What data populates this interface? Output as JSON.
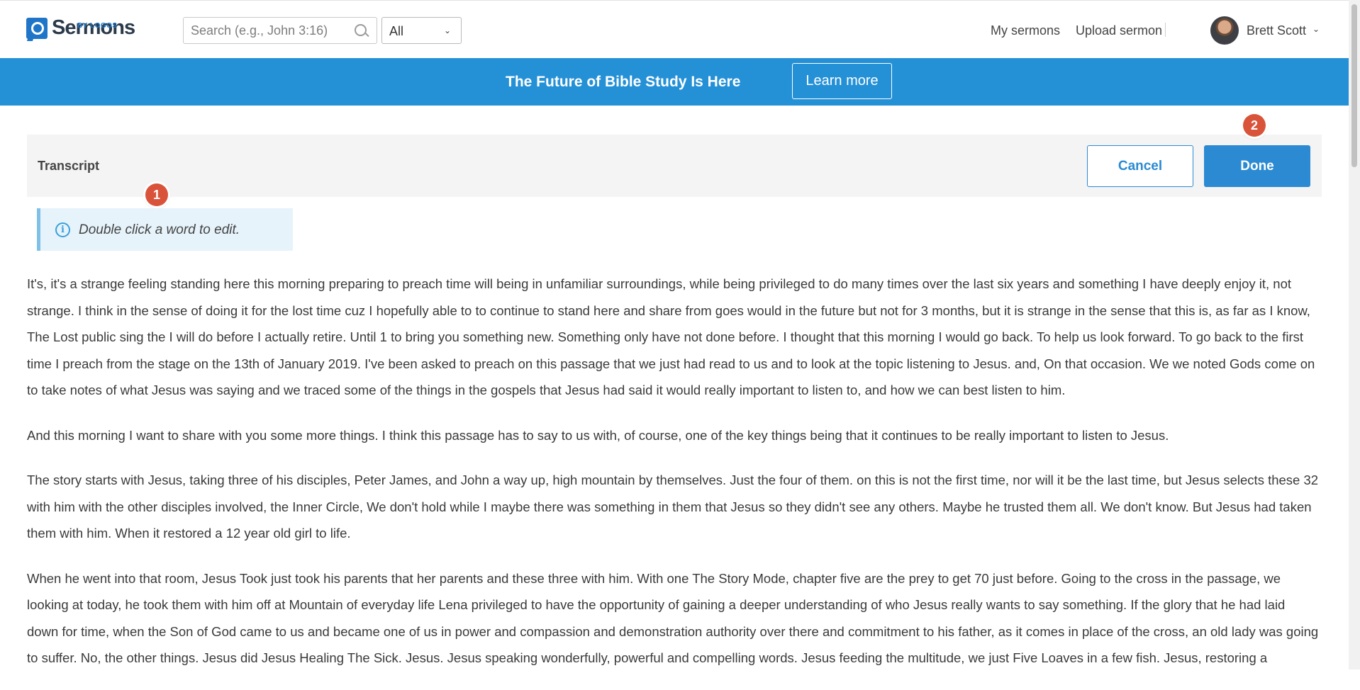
{
  "topbar": {
    "logo_text": "Sermons",
    "logo_sub": "BY LOGOS",
    "search_placeholder": "Search (e.g., John 3:16)",
    "filter_value": "All",
    "nav": {
      "my_sermons": "My sermons",
      "upload_sermon": "Upload sermon"
    },
    "user_name": "Brett Scott"
  },
  "banner": {
    "title": "The Future of Bible Study Is Here",
    "cta": "Learn more",
    "color": "#2490d6"
  },
  "editor": {
    "title": "Transcript",
    "cancel_label": "Cancel",
    "done_label": "Done",
    "info_text": "Double click a word to edit.",
    "markers": [
      "1",
      "2"
    ],
    "accent": "#2b8ad1",
    "marker_color": "#d9533b"
  },
  "transcript": {
    "paragraphs": [
      "It's, it's a strange feeling standing here this morning preparing to preach time will being in unfamiliar surroundings, while being privileged to do many times over the last six years and something I have deeply enjoy it, not strange. I think in the sense of doing it for the lost time cuz I hopefully able to to continue to stand here and share from goes would in the future but not for 3 months, but it is strange in the sense that this is, as far as I know, The Lost public sing the I will do before I actually retire. Until 1 to bring you something new. Something only have not done before. I thought that this morning I would go back. To help us look forward. To go back to the first time I preach from the stage on the 13th of January 2019. I've been asked to preach on this passage that we just had read to us and to look at the topic listening to Jesus. and, On that occasion. We we noted Gods come on to take notes of what Jesus was saying and we traced some of the things in the gospels that Jesus had said it would really important to listen to, and how we can best listen to him.",
      "And this morning I want to share with you some more things. I think this passage has to say to us with, of course, one of the key things being that it continues to be really important to listen to Jesus.",
      "The story starts with Jesus, taking three of his disciples, Peter James, and John a way up, high mountain by themselves. Just the four of them. on this is not the first time, nor will it be the last time, but Jesus selects these 32 with him with the other disciples involved, the Inner Circle, We don't hold while I maybe there was something in them that Jesus so they didn't see any others. Maybe he trusted them all. We don't know. But Jesus had taken them with him. When it restored a 12 year old girl to life.",
      "When he went into that room, Jesus Took just took his parents that her parents and these three with him. With one The Story Mode, chapter five are the prey to get 70 just before. Going to the cross in the passage, we looking at today, he took them with him off at Mountain of everyday life Lena privileged to have the opportunity of gaining a deeper understanding of who Jesus really wants to say something. If the glory that he had laid down for time, when the Son of God came to us and became one of us in power and compassion and demonstration authority over there and commitment to his father, as it comes in place of the cross, an old lady was going to suffer. No, the other things. Jesus did Jesus Healing The Sick. Jesus. Jesus speaking wonderfully, powerful and compelling words. Jesus feeding the multitude, we just Five Loaves in a few fish. Jesus, restoring a"
    ]
  }
}
